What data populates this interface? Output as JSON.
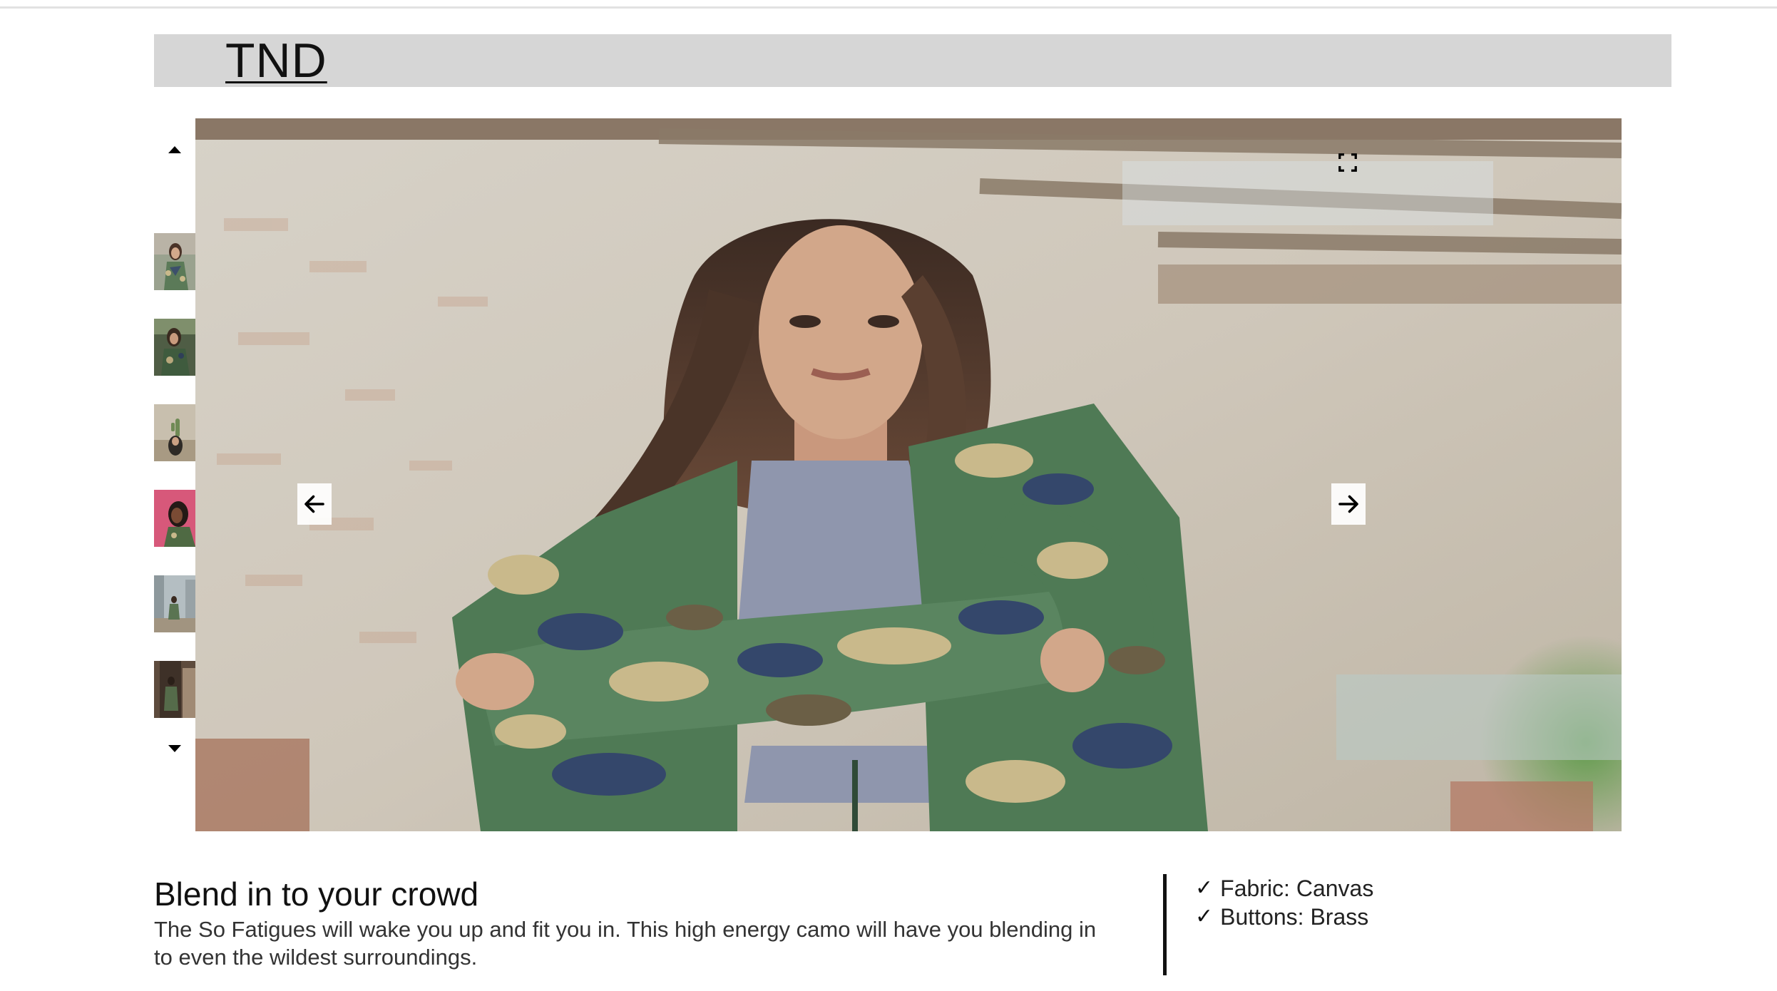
{
  "brand": {
    "name": "TND"
  },
  "gallery": {
    "scroll_up_icon": "triangle-up",
    "scroll_down_icon": "triangle-down",
    "thumbnails": [
      {
        "alt": "camo jacket front",
        "bg": "#8c9a82"
      },
      {
        "alt": "camo jacket forest",
        "bg": "#5b6a4e"
      },
      {
        "alt": "camo jacket cactus",
        "bg": "#b8ad98"
      },
      {
        "alt": "camo jacket pink",
        "bg": "#d7587a"
      },
      {
        "alt": "camo jacket street",
        "bg": "#a3aeb3"
      },
      {
        "alt": "camo jacket doorway",
        "bg": "#6d5b4b"
      }
    ],
    "prev_icon": "arrow-left",
    "next_icon": "arrow-right",
    "fullscreen_icon": "fullscreen-corners"
  },
  "product": {
    "title": "Blend in to your crowd",
    "description": "The So Fatigues will wake you up and fit you in. This high energy camo will have you blending in to even the wildest surroundings.",
    "features": [
      {
        "check": "✓",
        "text": "Fabric: Canvas"
      },
      {
        "check": "✓",
        "text": "Buttons: Brass"
      }
    ]
  },
  "colors": {
    "header_bg": "#d6d6d6",
    "camo_green": "#4f7a55",
    "camo_tan": "#c9b98b",
    "camo_navy": "#34476b"
  }
}
